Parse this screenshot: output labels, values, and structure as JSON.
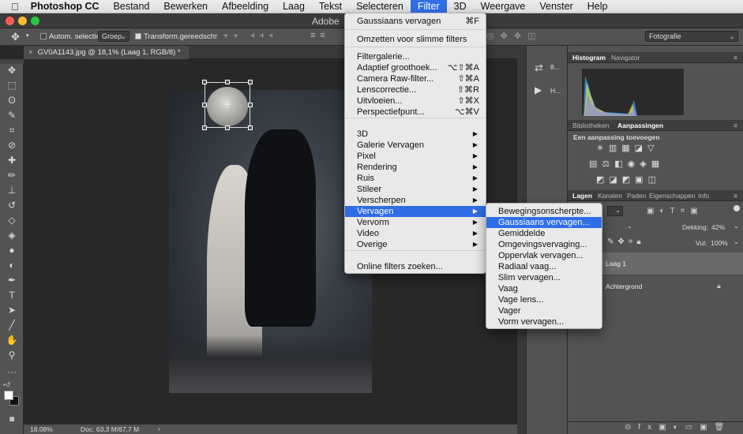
{
  "menubar": {
    "apple": "",
    "app": "Photoshop CC",
    "items": [
      "Bestand",
      "Bewerken",
      "Afbeelding",
      "Laag",
      "Tekst",
      "Selecteren",
      "Filter",
      "3D",
      "Weergave",
      "Venster",
      "Help"
    ]
  },
  "window": {
    "title": "Adobe"
  },
  "options": {
    "autoselect_label": "Autom. selectie:",
    "autoselect_value": "Groep",
    "transform_label": "Transform.gereedsch.",
    "workspace": "Fotografie"
  },
  "document": {
    "tab": "GV0A1143.jpg @ 18,1% (Laag 1, RGB/8) *",
    "zoom": "18,08%",
    "doc_info": "Doc: 63,3 M/67,7 M"
  },
  "midpanel": {
    "item1": "8...",
    "item2": "H..."
  },
  "filter_menu": {
    "items": [
      {
        "label": "Gaussiaans vervagen",
        "shortcut": "⌘F"
      },
      {
        "label": "Omzetten voor slimme filters",
        "shortcut": ""
      },
      {
        "label": "Filtergalerie...",
        "shortcut": ""
      },
      {
        "label": "Adaptief groothoek...",
        "shortcut": "⌥⇧⌘A"
      },
      {
        "label": "Camera Raw-filter...",
        "shortcut": "⇧⌘A"
      },
      {
        "label": "Lenscorrectie...",
        "shortcut": "⇧⌘R"
      },
      {
        "label": "Uitvloeien...",
        "shortcut": "⇧⌘X"
      },
      {
        "label": "Perspectiefpunt...",
        "shortcut": "⌥⌘V"
      },
      {
        "label": "3D",
        "shortcut": ""
      },
      {
        "label": "Galerie Vervagen",
        "shortcut": ""
      },
      {
        "label": "Pixel",
        "shortcut": ""
      },
      {
        "label": "Rendering",
        "shortcut": ""
      },
      {
        "label": "Ruis",
        "shortcut": ""
      },
      {
        "label": "Stileer",
        "shortcut": ""
      },
      {
        "label": "Verscherpen",
        "shortcut": ""
      },
      {
        "label": "Vervagen",
        "shortcut": ""
      },
      {
        "label": "Vervorm",
        "shortcut": ""
      },
      {
        "label": "Video",
        "shortcut": ""
      },
      {
        "label": "Overige",
        "shortcut": ""
      },
      {
        "label": "Online filters zoeken...",
        "shortcut": ""
      }
    ]
  },
  "blur_submenu": {
    "items": [
      "Bewegingsonscherpte...",
      "Gaussiaans vervagen...",
      "Gemiddelde",
      "Omgevingsvervaging...",
      "Oppervlak vervagen...",
      "Radiaal vaag...",
      "Slim vervagen...",
      "Vaag",
      "Vage lens...",
      "Vager",
      "Vorm vervagen..."
    ]
  },
  "panels": {
    "tab_histogram": "Histogram",
    "tab_navigator": "Navigator",
    "tab_libraries": "Bibliotheken",
    "tab_adjustments": "Aanpassingen",
    "add_adjustment": "Een aanpassing toevoegen",
    "tab_layers": "Lagen",
    "tab_channels": "Kanalen",
    "tab_paths": "Paden",
    "tab_properties": "Eigenschappen",
    "tab_info": "Info",
    "opacity_label": "Dekking:",
    "opacity_value": "42%",
    "fill_label": "Vul:",
    "fill_value": "100%",
    "layers": [
      "Laag 1",
      "Achtergrond"
    ]
  },
  "colors": {
    "accent": "#2f6ee6",
    "panel": "#535353"
  }
}
